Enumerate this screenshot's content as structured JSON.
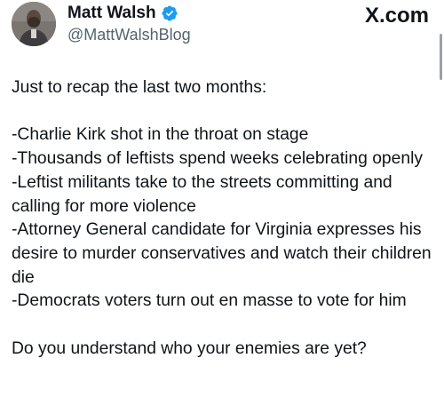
{
  "author": {
    "name": "Matt Walsh",
    "handle": "@MattWalshBlog",
    "verified_icon": "verified-badge-icon",
    "avatar_icon": "avatar-photo"
  },
  "brand": {
    "logo_text": "X.com"
  },
  "colors": {
    "verified": "#1d9bf0",
    "text": "#0f1419",
    "secondary": "#536471"
  },
  "post": {
    "intro": "Just to recap the last two months:",
    "items": [
      "-Charlie Kirk shot in the throat on stage",
      "-Thousands of leftists spend weeks celebrating openly",
      "-Leftist militants take to the streets committing and calling for more violence",
      "-Attorney General candidate for Virginia expresses his desire to murder conservatives and watch their children die",
      "-Democrats voters turn out en masse to vote for him"
    ],
    "closing": "Do you understand who your enemies are yet?"
  }
}
